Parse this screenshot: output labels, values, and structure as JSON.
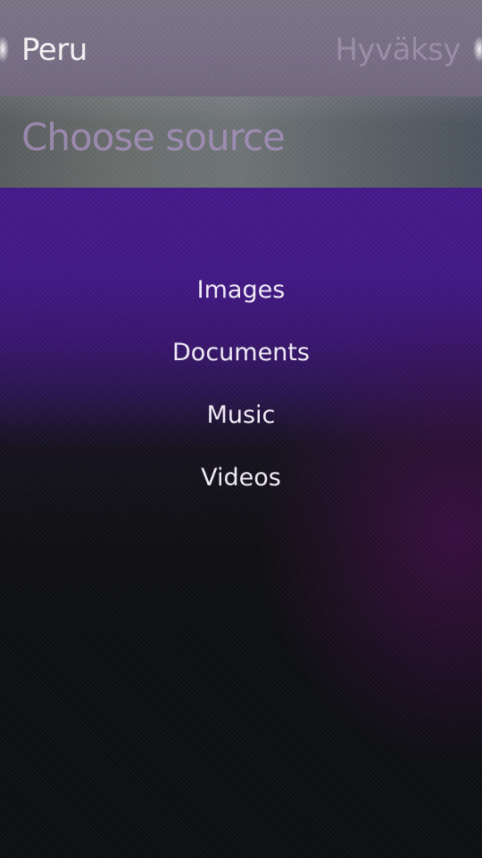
{
  "header": {
    "cancel_label": "Peru",
    "accept_label": "Hyväksy"
  },
  "title": "Choose source",
  "menu": {
    "items": [
      {
        "label": "Images"
      },
      {
        "label": "Documents"
      },
      {
        "label": "Music"
      },
      {
        "label": "Videos"
      }
    ]
  },
  "colors": {
    "header_bg": "#786f86",
    "background_accent": "#47198d",
    "title_text": "#af96c8",
    "accept_disabled_text": "#b4aac3"
  }
}
